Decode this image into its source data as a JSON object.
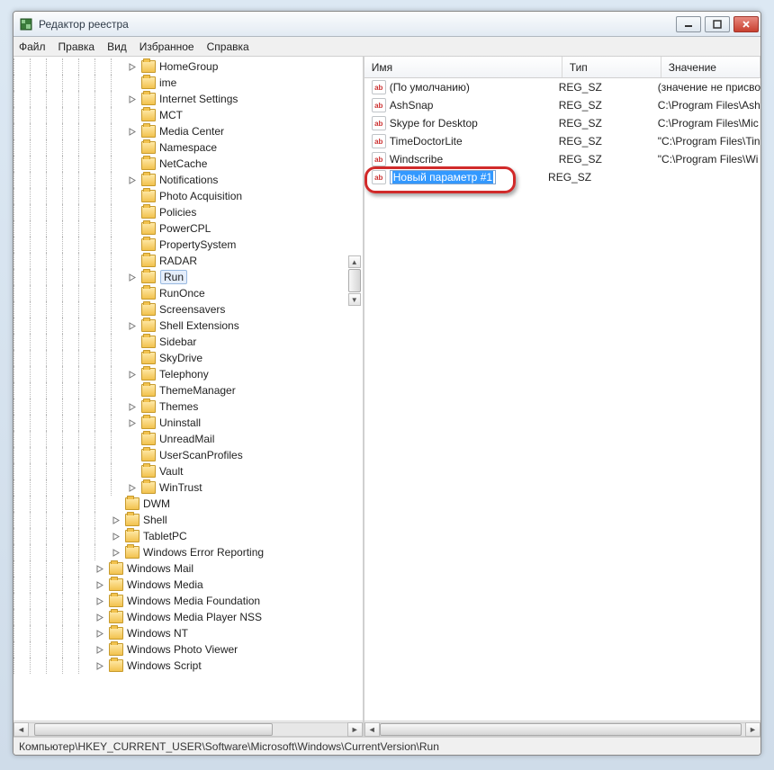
{
  "window": {
    "title": "Редактор реестра"
  },
  "menubar": [
    "Файл",
    "Правка",
    "Вид",
    "Избранное",
    "Справка"
  ],
  "tree": {
    "selected": "Run",
    "items": [
      {
        "depth": 7,
        "exp": 1,
        "label": "HomeGroup"
      },
      {
        "depth": 7,
        "exp": 0,
        "label": "ime"
      },
      {
        "depth": 7,
        "exp": 1,
        "label": "Internet Settings"
      },
      {
        "depth": 7,
        "exp": 0,
        "label": "MCT"
      },
      {
        "depth": 7,
        "exp": 1,
        "label": "Media Center"
      },
      {
        "depth": 7,
        "exp": 0,
        "label": "Namespace"
      },
      {
        "depth": 7,
        "exp": 0,
        "label": "NetCache"
      },
      {
        "depth": 7,
        "exp": 1,
        "label": "Notifications"
      },
      {
        "depth": 7,
        "exp": 0,
        "label": "Photo Acquisition"
      },
      {
        "depth": 7,
        "exp": 0,
        "label": "Policies"
      },
      {
        "depth": 7,
        "exp": 0,
        "label": "PowerCPL"
      },
      {
        "depth": 7,
        "exp": 0,
        "label": "PropertySystem"
      },
      {
        "depth": 7,
        "exp": 0,
        "label": "RADAR"
      },
      {
        "depth": 7,
        "exp": 1,
        "label": "Run",
        "selected": true
      },
      {
        "depth": 7,
        "exp": 0,
        "label": "RunOnce"
      },
      {
        "depth": 7,
        "exp": 0,
        "label": "Screensavers"
      },
      {
        "depth": 7,
        "exp": 1,
        "label": "Shell Extensions"
      },
      {
        "depth": 7,
        "exp": 0,
        "label": "Sidebar"
      },
      {
        "depth": 7,
        "exp": 0,
        "label": "SkyDrive"
      },
      {
        "depth": 7,
        "exp": 1,
        "label": "Telephony"
      },
      {
        "depth": 7,
        "exp": 0,
        "label": "ThemeManager"
      },
      {
        "depth": 7,
        "exp": 1,
        "label": "Themes"
      },
      {
        "depth": 7,
        "exp": 1,
        "label": "Uninstall"
      },
      {
        "depth": 7,
        "exp": 0,
        "label": "UnreadMail"
      },
      {
        "depth": 7,
        "exp": 0,
        "label": "UserScanProfiles"
      },
      {
        "depth": 7,
        "exp": 0,
        "label": "Vault"
      },
      {
        "depth": 7,
        "exp": 1,
        "label": "WinTrust"
      },
      {
        "depth": 6,
        "exp": 0,
        "label": "DWM"
      },
      {
        "depth": 6,
        "exp": 1,
        "label": "Shell"
      },
      {
        "depth": 6,
        "exp": 1,
        "label": "TabletPC"
      },
      {
        "depth": 6,
        "exp": 1,
        "label": "Windows Error Reporting"
      },
      {
        "depth": 5,
        "exp": 1,
        "label": "Windows Mail"
      },
      {
        "depth": 5,
        "exp": 1,
        "label": "Windows Media"
      },
      {
        "depth": 5,
        "exp": 1,
        "label": "Windows Media Foundation"
      },
      {
        "depth": 5,
        "exp": 1,
        "label": "Windows Media Player NSS"
      },
      {
        "depth": 5,
        "exp": 1,
        "label": "Windows NT"
      },
      {
        "depth": 5,
        "exp": 1,
        "label": "Windows Photo Viewer"
      },
      {
        "depth": 5,
        "exp": 1,
        "label": "Windows Script"
      }
    ]
  },
  "list": {
    "columns": {
      "name": "Имя",
      "type": "Тип",
      "value": "Значение"
    },
    "rows": [
      {
        "name": "(По умолчанию)",
        "type": "REG_SZ",
        "value": "(значение не присво"
      },
      {
        "name": "AshSnap",
        "type": "REG_SZ",
        "value": "C:\\Program Files\\Ash"
      },
      {
        "name": "Skype for Desktop",
        "type": "REG_SZ",
        "value": "C:\\Program Files\\Mic"
      },
      {
        "name": "TimeDoctorLite",
        "type": "REG_SZ",
        "value": "\"C:\\Program Files\\Tin"
      },
      {
        "name": "Windscribe",
        "type": "REG_SZ",
        "value": "\"C:\\Program Files\\Wi"
      }
    ],
    "edit_row": {
      "name": "Новый параметр #1",
      "type": "REG_SZ",
      "value": ""
    }
  },
  "statusbar": "Компьютер\\HKEY_CURRENT_USER\\Software\\Microsoft\\Windows\\CurrentVersion\\Run"
}
